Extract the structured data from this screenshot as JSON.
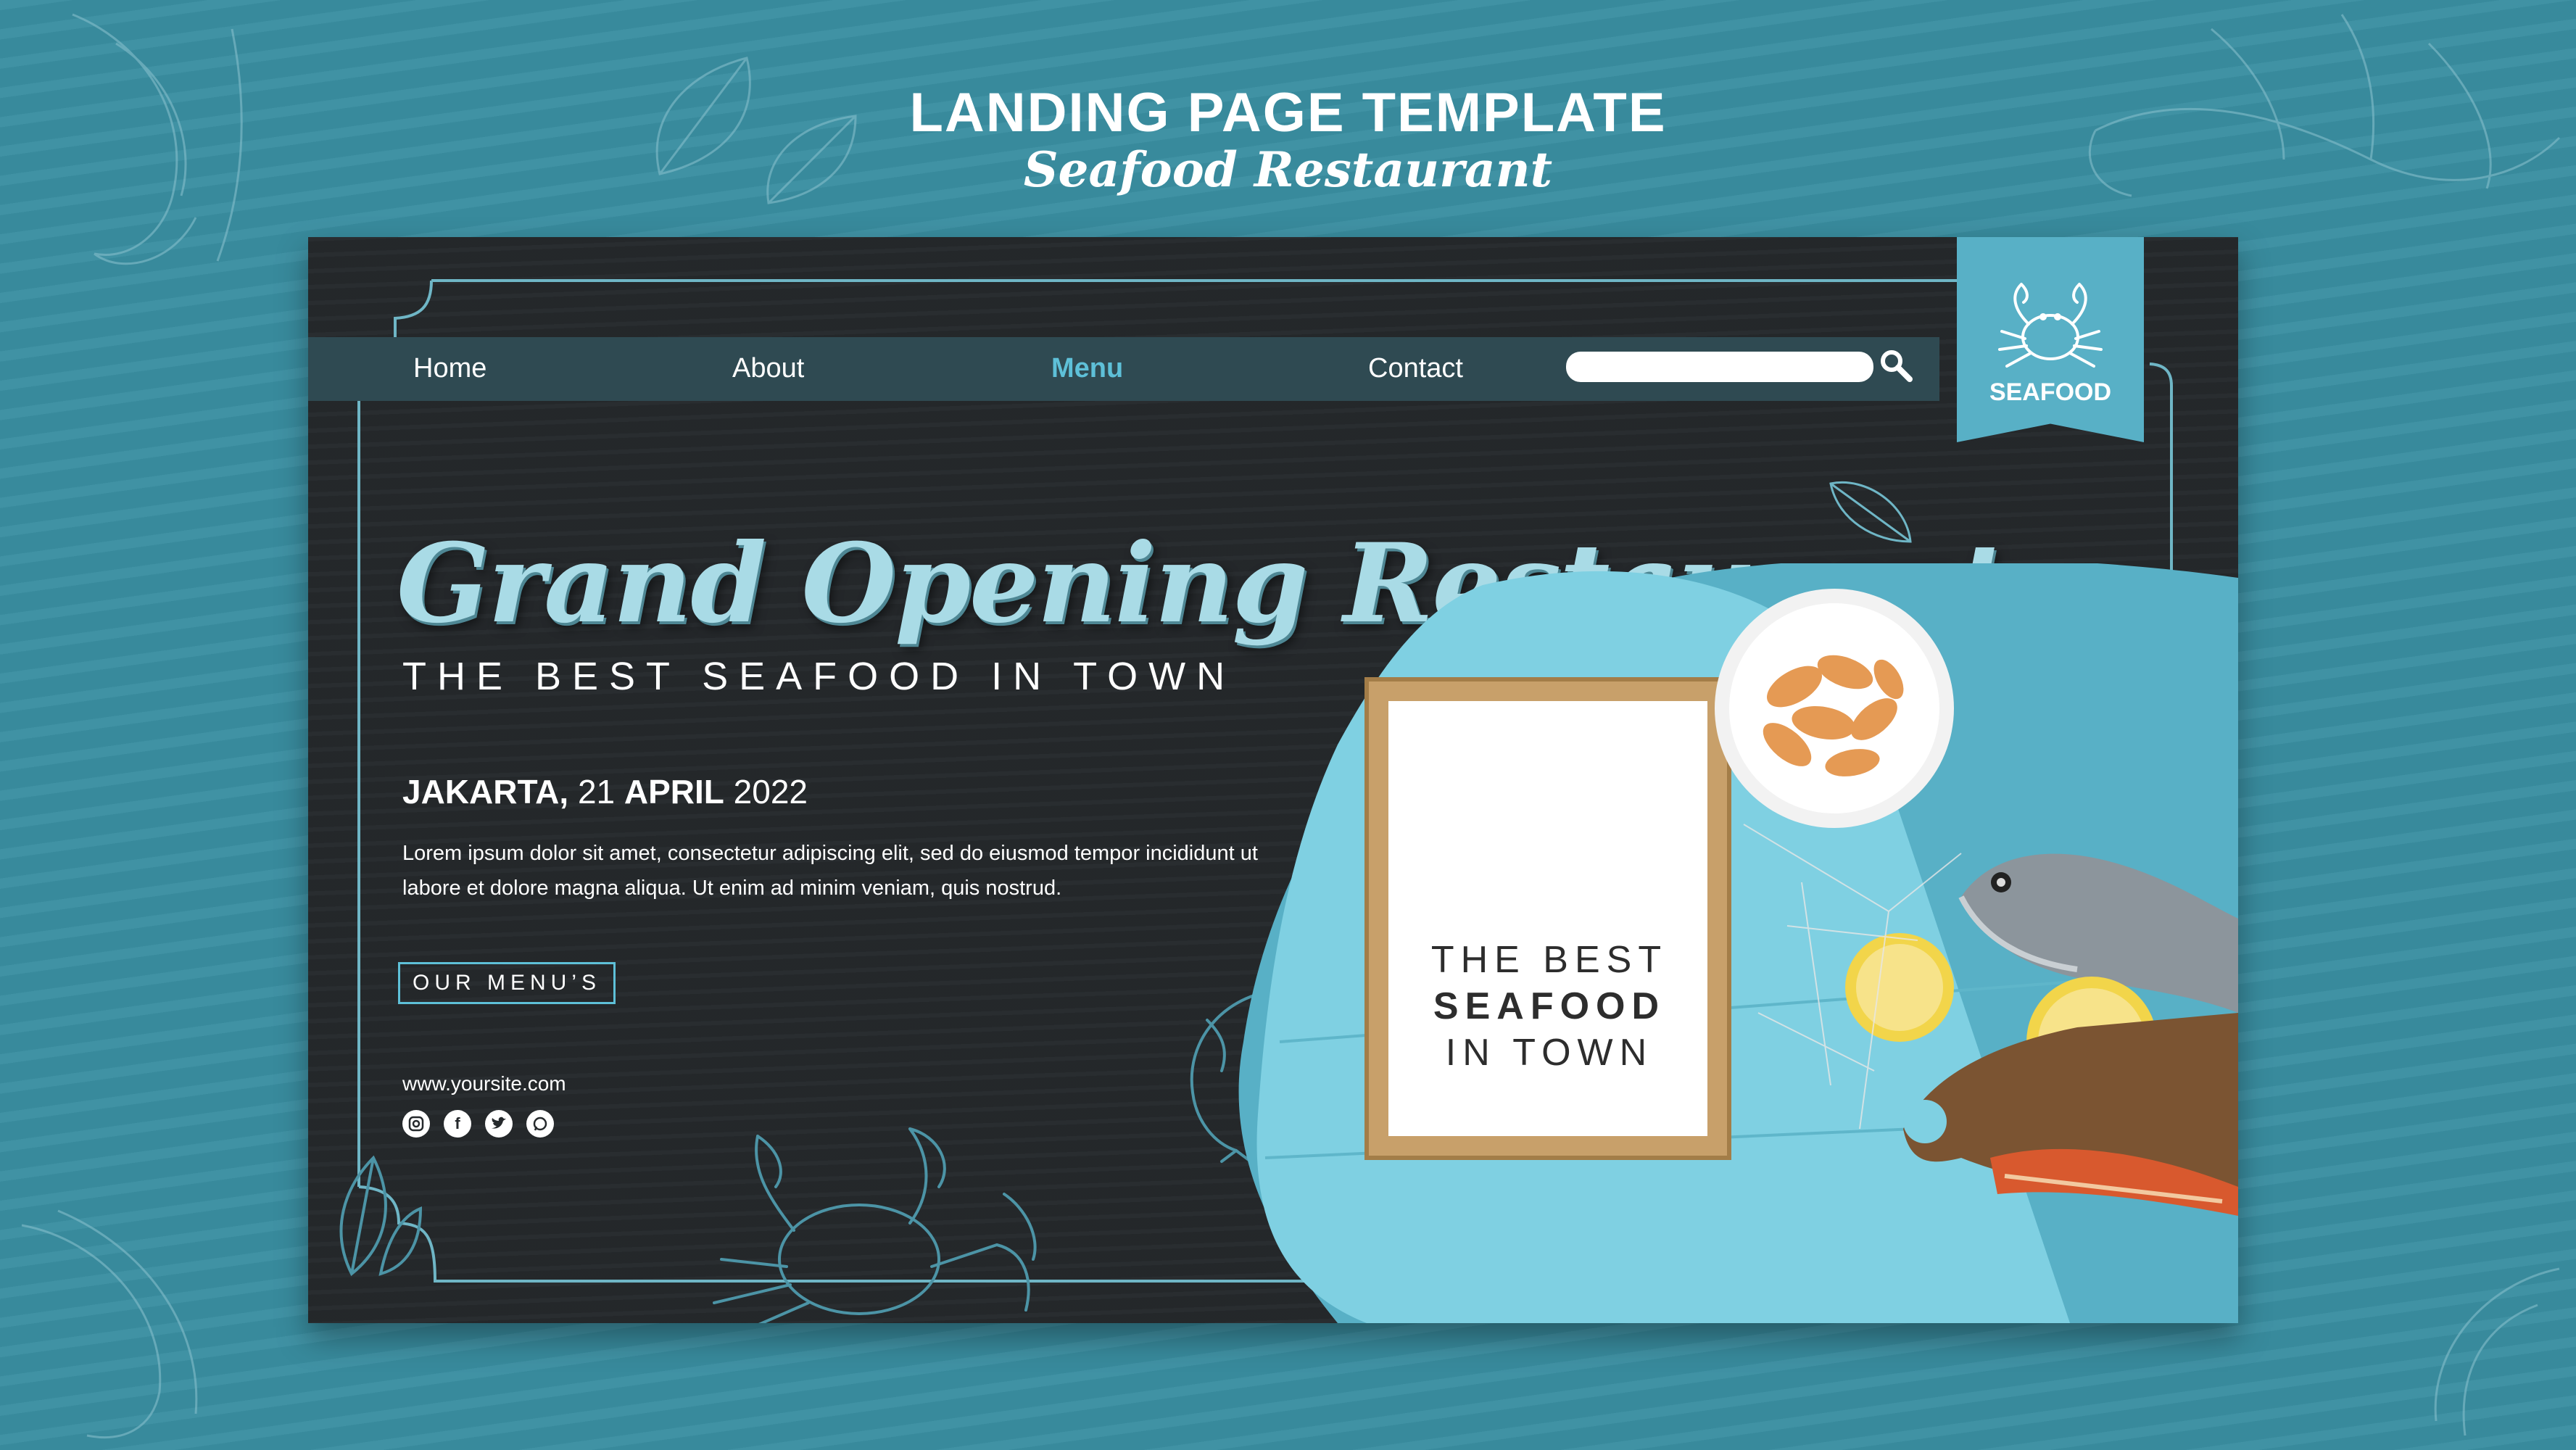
{
  "header": {
    "title": "LANDING PAGE TEMPLATE",
    "subtitle": "Seafood Restaurant"
  },
  "nav": {
    "items": [
      {
        "label": "Home"
      },
      {
        "label": "About"
      },
      {
        "label": "Menu",
        "active": true
      },
      {
        "label": "Contact"
      }
    ],
    "search_value": ""
  },
  "brand": {
    "label": "SEAFOOD",
    "icon": "crab-icon"
  },
  "hero": {
    "headline": "Grand Opening Restaurant",
    "tagline": "THE BEST SEAFOOD IN TOWN",
    "date": {
      "city": "JAKARTA,",
      "day": "21",
      "month": "APRIL",
      "year": "2022"
    },
    "body": "Lorem ipsum dolor sit amet, consectetur adipiscing elit, sed do eiusmod tempor incididunt ut labore et dolore magna aliqua. Ut enim ad minim veniam, quis nostrud.",
    "button_label": "OUR MENU’S",
    "website": "www.yoursite.com"
  },
  "social_icons": [
    "instagram-icon",
    "facebook-icon",
    "twitter-icon",
    "whatsapp-icon"
  ],
  "sign": {
    "line1": "THE BEST",
    "line2": "SEAFOOD",
    "line3": "IN TOWN"
  },
  "colors": {
    "background": "#3a8ea1",
    "card": "#25292c",
    "accent": "#5ec0d8",
    "ribbon": "#58b0c6",
    "headline": "#a9dbe6"
  }
}
